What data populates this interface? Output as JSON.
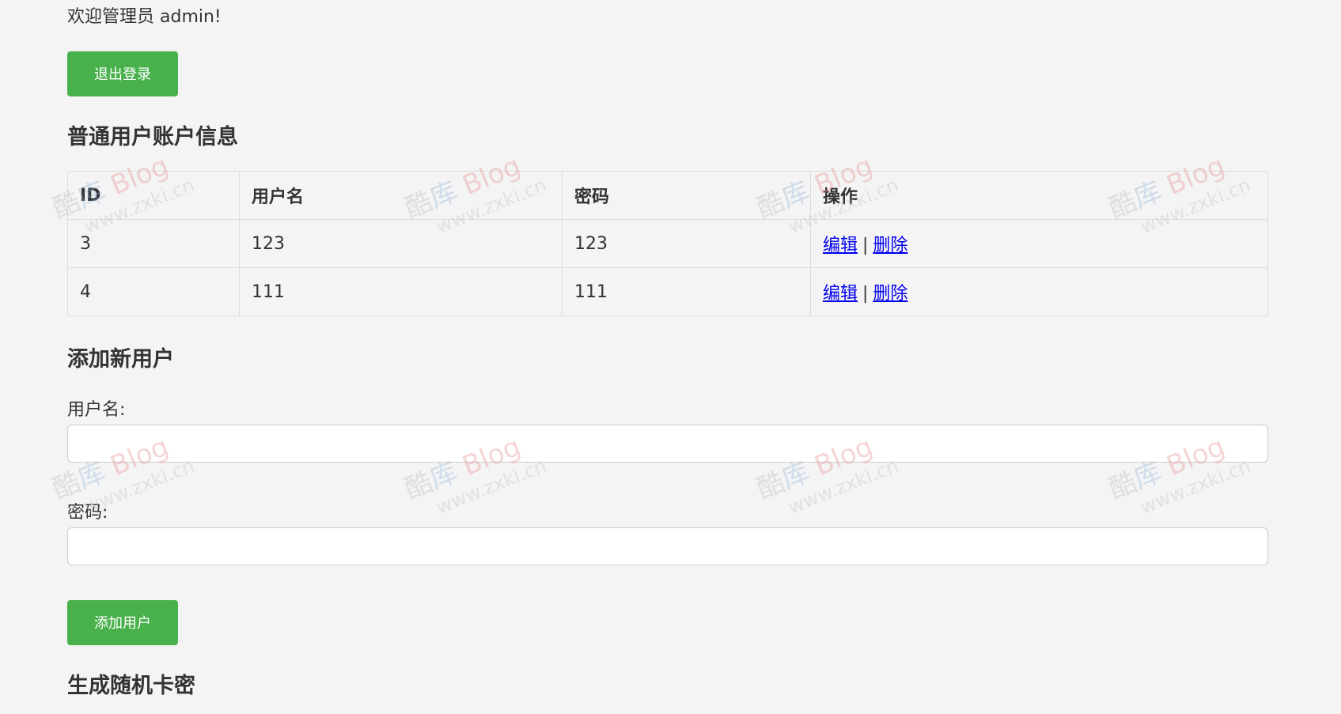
{
  "header": {
    "welcome_text": "欢迎管理员 admin!",
    "logout_label": "退出登录"
  },
  "users_section": {
    "title": "普通用户账户信息",
    "columns": [
      "ID",
      "用户名",
      "密码",
      "操作"
    ],
    "rows": [
      {
        "id": "3",
        "username": "123",
        "password": "123",
        "edit": "编辑",
        "sep": "|",
        "delete": "删除"
      },
      {
        "id": "4",
        "username": "111",
        "password": "111",
        "edit": "编辑",
        "sep": "|",
        "delete": "删除"
      }
    ]
  },
  "add_user_section": {
    "title": "添加新用户",
    "username_label": "用户名:",
    "username_value": "",
    "password_label": "密码:",
    "password_value": "",
    "submit_label": "添加用户"
  },
  "card_section": {
    "title": "生成随机卡密"
  },
  "watermark": {
    "brand_prefix": "酷",
    "brand_middle": "库",
    "brand_word": "Blog",
    "url": "www.zxki.cn"
  },
  "colors": {
    "button_green": "#48b14c",
    "link_blue": "#0000ee",
    "background": "#f4f4f4"
  }
}
